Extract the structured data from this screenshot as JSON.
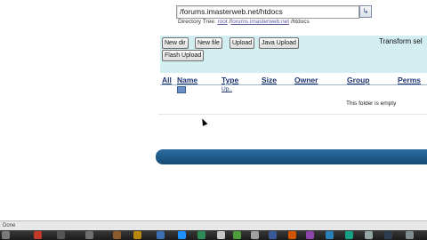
{
  "path_field": {
    "value": "/forums.imasterweb.net/htdocs"
  },
  "go_button": {
    "label": "↳"
  },
  "directory_tree": {
    "label": "Directory Tree:",
    "root": "root",
    "sep1": "/",
    "host": "forums.imasterweb.net",
    "sep2": "/",
    "current": "htdocs"
  },
  "toolbar": {
    "new_dir": "New dir",
    "new_file": "New file",
    "upload": "Upload",
    "java_upload": "Java Upload",
    "flash_upload": "Flash Upload",
    "transform": "Transform sel"
  },
  "table": {
    "columns": [
      "All",
      "Name",
      "Type",
      "Size",
      "Owner",
      "Group",
      "Perms"
    ],
    "up_link": "Up..",
    "empty_message": "This folder is empty"
  },
  "status_bar": {
    "text": "Done"
  },
  "colors": {
    "panel": "#d3eef0",
    "footer": "#1f5d8c",
    "link": "#1c3470"
  }
}
